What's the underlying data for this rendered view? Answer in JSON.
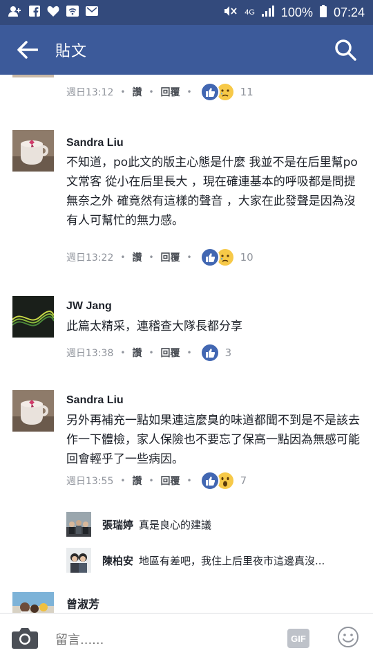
{
  "status_bar": {
    "left_icons": [
      "add-friend-icon",
      "facebook-icon",
      "heart-icon",
      "wifi-icon",
      "mail-icon"
    ],
    "right_icons": [
      "mute-icon",
      "4g-icon",
      "signal-icon",
      "battery-icon"
    ],
    "network": "4G",
    "battery": "100%",
    "time": "07:24"
  },
  "header": {
    "title": "貼文",
    "back_icon": "arrow-left-icon",
    "search_icon": "search-icon"
  },
  "comments": [
    {
      "partial": true,
      "time": "週日13:12",
      "like_label": "讚",
      "reply_label": "回覆",
      "reactions": [
        "like",
        "sad"
      ],
      "reaction_count": "11"
    },
    {
      "name": "Sandra Liu",
      "avatar": "coffee-cup-photo",
      "text": "不知道，po此文的版主心態是什麼 我並不是在后里幫po文常客 從小在后里長大 ，現在確連基本的呼吸都是問提 無奈之外 確竟然有這樣的聲音 ，大家在此發聲是因為沒有人可幫忙的無力感。",
      "time": "週日13:22",
      "like_label": "讚",
      "reply_label": "回覆",
      "reactions": [
        "like",
        "sad"
      ],
      "reaction_count": "10"
    },
    {
      "name": "JW Jang",
      "avatar": "green-wave-photo",
      "text": "此篇太精采，連稽查大隊長都分享",
      "time": "週日13:38",
      "like_label": "讚",
      "reply_label": "回覆",
      "reactions": [
        "like"
      ],
      "reaction_count": "3"
    },
    {
      "name": "Sandra Liu",
      "avatar": "coffee-cup-photo",
      "text": "另外再補充一點如果連這麼臭的味道都聞不到是不是該去作一下體檢，家人保險也不要忘了保高一點因為無感可能回會輕乎了一些病因。",
      "time": "週日13:55",
      "like_label": "讚",
      "reply_label": "回覆",
      "reactions": [
        "like",
        "wow"
      ],
      "reaction_count": "7"
    }
  ],
  "replies": [
    {
      "name": "張瑞婷",
      "text": "真是良心的建議",
      "avatar": "group-photo"
    },
    {
      "name": "陳柏安",
      "text": "地區有差吧，我住上后里夜市這邊真沒...",
      "avatar": "portrait-photo"
    }
  ],
  "next_comment": {
    "name": "曾淑芳",
    "avatar": "family-photo"
  },
  "composer": {
    "placeholder": "留言......",
    "camera_icon": "camera-icon",
    "gif_label": "GIF",
    "emoji_icon": "smiley-icon"
  },
  "colors": {
    "status_bar": "#334a7c",
    "app_bar": "#3c5a9a",
    "like_blue": "#4267b2",
    "meta_gray": "#90949c"
  }
}
